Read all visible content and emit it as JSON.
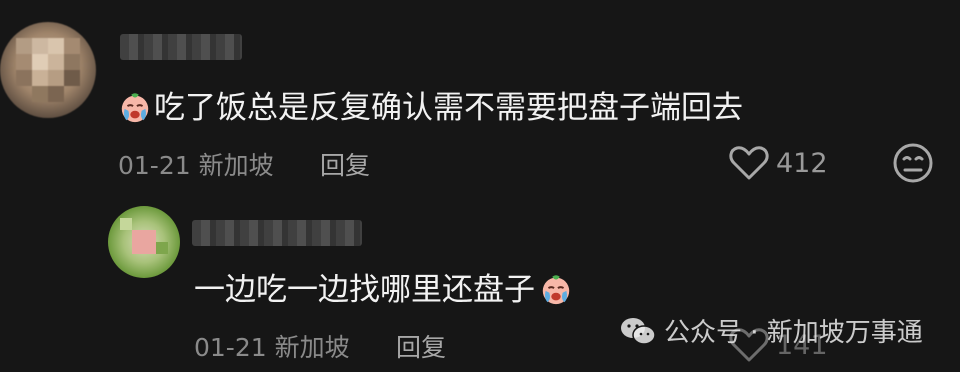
{
  "comments": [
    {
      "text": "吃了饭总是反复确认需不需要把盘子端回去",
      "date": "01-21",
      "location": "新加坡",
      "reply_label": "回复",
      "like_count": "412",
      "emoji": "crying-face-emoji"
    },
    {
      "text": "一边吃一边找哪里还盘子",
      "date": "01-21",
      "location": "新加坡",
      "reply_label": "回复",
      "like_count": "141",
      "emoji": "crying-face-emoji"
    }
  ],
  "watermark": {
    "text": "公众号 · 新加坡万事通",
    "icon": "wechat-icon"
  },
  "colors": {
    "background": "#161616",
    "text": "#f2f2f2",
    "meta": "#8a8a8a"
  }
}
